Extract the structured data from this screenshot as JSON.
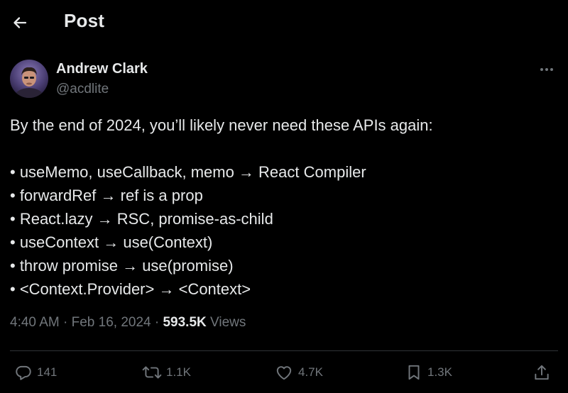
{
  "header": {
    "title": "Post",
    "back_icon": "arrow-left-icon"
  },
  "author": {
    "name": "Andrew Clark",
    "handle": "@acdlite",
    "more_icon": "more-horizontal-icon"
  },
  "post": {
    "lines": [
      "By the end of 2024, you’ll likely never need these APIs again:",
      "",
      "• useMemo, useCallback, memo → React Compiler",
      "• forwardRef → ref is a prop",
      "• React.lazy → RSC, promise-as-child",
      "• useContext → use(Context)",
      "• throw promise → use(promise)",
      "• <Context.Provider> → <Context>"
    ]
  },
  "meta": {
    "time": "4:40 AM",
    "separator": " · ",
    "date": "Feb 16, 2024",
    "views_count": "593.5K",
    "views_label": " Views"
  },
  "actions": {
    "reply_count": "141",
    "repost_count": "1.1K",
    "like_count": "4.7K",
    "bookmark_count": "1.3K"
  },
  "colors": {
    "background": "#000000",
    "text_primary": "#e7e9ea",
    "text_secondary": "#71767b",
    "divider": "#2f3336"
  }
}
